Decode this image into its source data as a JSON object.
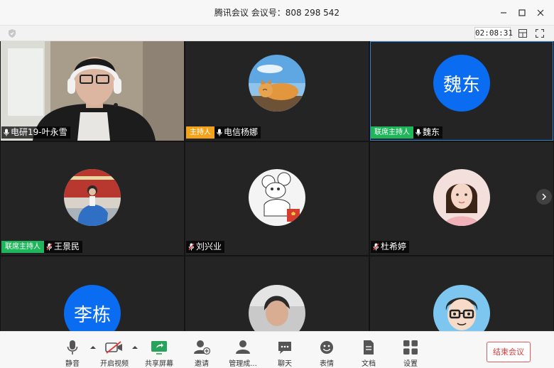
{
  "window": {
    "title": "腾讯会议 会议号：808 298 542"
  },
  "subbar": {
    "timer": "02:08:31"
  },
  "roles": {
    "host": "主持人",
    "cohost": "联席主持人"
  },
  "participants": [
    {
      "name": "电研19-叶永雪",
      "role": "",
      "avatar": "video-camera-feed",
      "mic": "on"
    },
    {
      "name": "电信杨娜",
      "role": "host",
      "avatar": "cat-photo",
      "mic": "on"
    },
    {
      "name": "魏东",
      "role": "cohost",
      "avatar_text": "魏东",
      "mic": "on"
    },
    {
      "name": "王景民",
      "role": "cohost",
      "avatar": "person-photo",
      "mic": "muted"
    },
    {
      "name": "刘兴业",
      "role": "",
      "avatar": "cartoon-mouse",
      "mic": "muted"
    },
    {
      "name": "杜希婷",
      "role": "",
      "avatar": "girl-photo",
      "mic": "muted"
    },
    {
      "name": "",
      "role": "",
      "avatar_text": "李栋"
    },
    {
      "name": "",
      "role": "",
      "avatar": "boy-photo"
    },
    {
      "name": "",
      "role": "",
      "avatar": "cartoon-glasses"
    }
  ],
  "toolbar": {
    "mute": "静音",
    "video": "开启视频",
    "share": "共享屏幕",
    "invite": "邀请",
    "members": "管理成...",
    "chat": "聊天",
    "emoji": "表情",
    "docs": "文档",
    "settings": "设置",
    "end": "结束会议"
  },
  "colors": {
    "accent": "#0a6cf0",
    "host": "#f2a31b",
    "cohost": "#1fb65b",
    "end": "#e03b3b"
  }
}
